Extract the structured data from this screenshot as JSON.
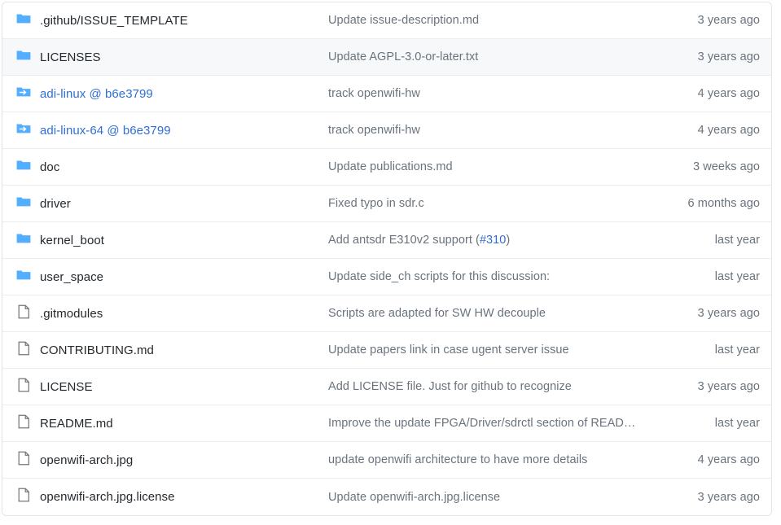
{
  "colors": {
    "folder_blue": "#54aeff",
    "link_blue": "#2f6fd4",
    "text_primary": "#24292e",
    "text_muted": "#6a737d",
    "border": "#eaecef",
    "row_alt_bg": "#f6f8fa"
  },
  "rows": [
    {
      "icon": "folder-icon",
      "kind": "folder",
      "name": ".github/ISSUE_TEMPLATE",
      "is_link": false,
      "message": "Update issue-description.md",
      "issue_ref": "",
      "time": "3 years ago",
      "highlighted": false
    },
    {
      "icon": "folder-icon",
      "kind": "folder",
      "name": "LICENSES",
      "is_link": false,
      "message": "Update AGPL-3.0-or-later.txt",
      "issue_ref": "",
      "time": "3 years ago",
      "highlighted": true
    },
    {
      "icon": "submodule-icon",
      "kind": "submodule",
      "name": "adi-linux @ b6e3799",
      "is_link": true,
      "message": "track openwifi-hw",
      "issue_ref": "",
      "time": "4 years ago",
      "highlighted": false
    },
    {
      "icon": "submodule-icon",
      "kind": "submodule",
      "name": "adi-linux-64 @ b6e3799",
      "is_link": true,
      "message": "track openwifi-hw",
      "issue_ref": "",
      "time": "4 years ago",
      "highlighted": false
    },
    {
      "icon": "folder-icon",
      "kind": "folder",
      "name": "doc",
      "is_link": false,
      "message": "Update publications.md",
      "issue_ref": "",
      "time": "3 weeks ago",
      "highlighted": false
    },
    {
      "icon": "folder-icon",
      "kind": "folder",
      "name": "driver",
      "is_link": false,
      "message": "Fixed typo in sdr.c",
      "issue_ref": "",
      "time": "6 months ago",
      "highlighted": false
    },
    {
      "icon": "folder-icon",
      "kind": "folder",
      "name": "kernel_boot",
      "is_link": false,
      "message": "Add antsdr E310v2 support (",
      "issue_ref": "#310",
      "message_after": ")",
      "time": "last year",
      "highlighted": false
    },
    {
      "icon": "folder-icon",
      "kind": "folder",
      "name": "user_space",
      "is_link": false,
      "message": "Update side_ch scripts for this discussion:",
      "issue_ref": "",
      "time": "last year",
      "highlighted": false
    },
    {
      "icon": "file-icon",
      "kind": "file",
      "name": ".gitmodules",
      "is_link": false,
      "message": "Scripts are adapted for SW HW decouple",
      "issue_ref": "",
      "time": "3 years ago",
      "highlighted": false
    },
    {
      "icon": "file-icon",
      "kind": "file",
      "name": "CONTRIBUTING.md",
      "is_link": false,
      "message": "Update papers link in case ugent server issue",
      "issue_ref": "",
      "time": "last year",
      "highlighted": false
    },
    {
      "icon": "file-icon",
      "kind": "file",
      "name": "LICENSE",
      "is_link": false,
      "message": "Add LICENSE file. Just for github to recognize",
      "issue_ref": "",
      "time": "3 years ago",
      "highlighted": false
    },
    {
      "icon": "file-icon",
      "kind": "file",
      "name": "README.md",
      "is_link": false,
      "message": "Improve the update FPGA/Driver/sdrctl section of README.",
      "issue_ref": "",
      "time": "last year",
      "highlighted": false
    },
    {
      "icon": "file-icon",
      "kind": "file",
      "name": "openwifi-arch.jpg",
      "is_link": false,
      "message": "update openwifi architecture to have more details",
      "issue_ref": "",
      "time": "4 years ago",
      "highlighted": false
    },
    {
      "icon": "file-icon",
      "kind": "file",
      "name": "openwifi-arch.jpg.license",
      "is_link": false,
      "message": "Update openwifi-arch.jpg.license",
      "issue_ref": "",
      "time": "3 years ago",
      "highlighted": false
    }
  ]
}
